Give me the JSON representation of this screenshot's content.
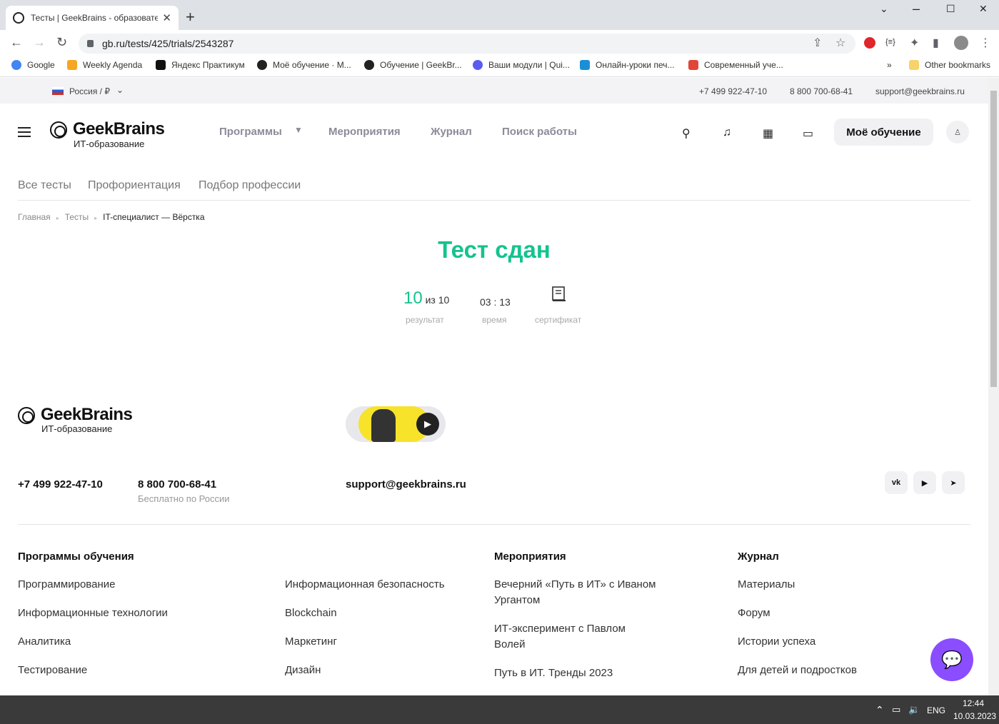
{
  "browser": {
    "tab_title": "Тесты | GeekBrains - образовате",
    "tab_close": "✕",
    "new_tab": "+",
    "win_min": "⌄",
    "win_max": "–",
    "win_restore": "☐",
    "win_close": "✕",
    "url": "gb.ru/tests/425/trials/2543287"
  },
  "bookmarks": [
    {
      "label": "Google",
      "color": "#4285f4"
    },
    {
      "label": "Weekly Agenda",
      "color": "#f5a623"
    },
    {
      "label": "Яндекс Практикум",
      "color": "#111111"
    },
    {
      "label": "Моё обучение · М...",
      "color": "#222222"
    },
    {
      "label": "Обучение | GeekBr...",
      "color": "#222222"
    },
    {
      "label": "Ваши модули | Qui...",
      "color": "#5b5bf0"
    },
    {
      "label": "Онлайн-уроки печ...",
      "color": "#1a8fd6"
    },
    {
      "label": "Современный уче...",
      "color": "#e0463a"
    }
  ],
  "bookmarks_more": "»",
  "other_bookmarks": "Other bookmarks",
  "topbar": {
    "region": "Россия / ₽",
    "phone1": "+7 499 922-47-10",
    "phone2": "8 800 700-68-41",
    "email": "support@geekbrains.ru"
  },
  "logo": {
    "name": "GeekBrains",
    "subtitle": "ИТ-образование"
  },
  "nav": {
    "programs": "Программы",
    "events": "Мероприятия",
    "journal": "Журнал",
    "jobs": "Поиск работы",
    "my_learning": "Моё обучение"
  },
  "subnav": [
    "Все тесты",
    "Профориентация",
    "Подбор профессии"
  ],
  "breadcrumbs": [
    "Главная",
    "Тесты",
    "IT-специалист — Вёрстка"
  ],
  "result": {
    "title": "Тест сдан",
    "score": "10",
    "score_total": "из 10",
    "score_label": "результат",
    "time": "03 : 13",
    "time_label": "время",
    "certificate_label": "сертификат"
  },
  "footer": {
    "phone1": "+7 499 922-47-10",
    "phone2": "8 800 700-68-41",
    "phone2_note": "Бесплатно по России",
    "email": "support@geekbrains.ru",
    "social": [
      "vk",
      "yt",
      "tg"
    ],
    "col_programs_title": "Программы обучения",
    "programs_col1": [
      "Программирование",
      "Информационные технологии",
      "Аналитика",
      "Тестирование"
    ],
    "programs_col2": [
      "Информационная безопасность",
      "Blockchain",
      "Маркетинг",
      "Дизайн"
    ],
    "col_events_title": "Мероприятия",
    "events": [
      "Вечерний «Путь в ИТ» с Иваном Ургантом",
      "ИТ-эксперимент с Павлом Волей",
      "Путь в ИТ. Тренды 2023"
    ],
    "col_journal_title": "Журнал",
    "journal": [
      "Материалы",
      "Форум",
      "Истории успеха",
      "Для детей и подростков"
    ]
  },
  "taskbar": {
    "lang": "ENG",
    "time": "12:44",
    "date": "10.03.2023"
  },
  "colors": {
    "accent_green": "#14c38e",
    "chat_purple": "#8a4dff"
  }
}
